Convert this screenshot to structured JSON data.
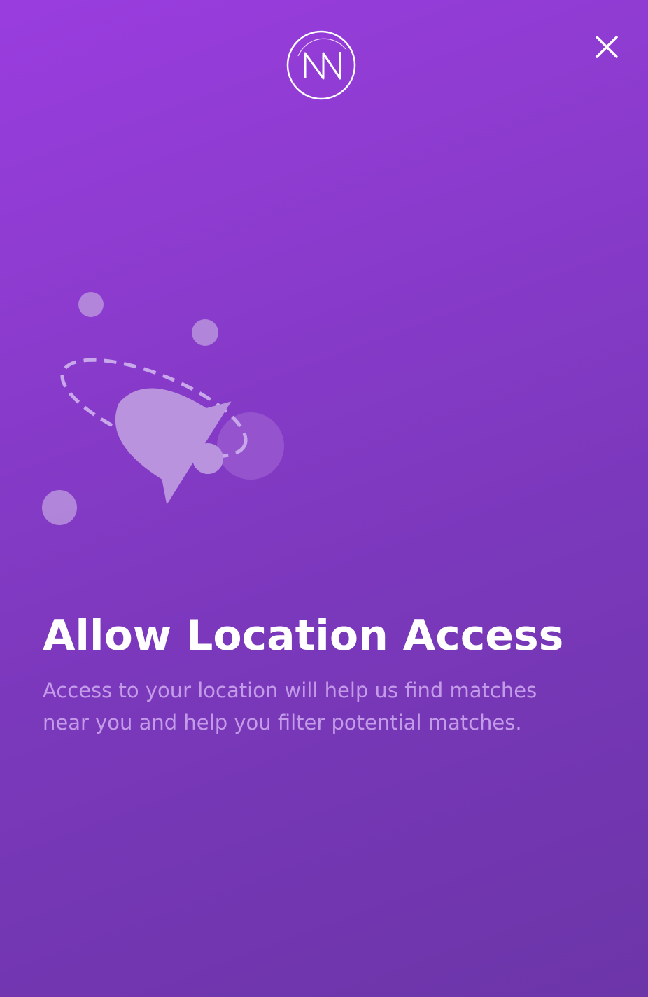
{
  "app": {
    "logo_icon": "monogram-m-logo-icon",
    "close_icon": "close-icon",
    "illustration_icon": "notification-bell-icon"
  },
  "permission": {
    "title": "Allow Location Access",
    "description": "Access to your location will help us find matches\nnear you and help you filter potential matches."
  },
  "colors": {
    "gradient_top": "#9a3ddf",
    "gradient_bottom": "#6c35a8",
    "title_text": "#ffffff",
    "description_text": "#c49be8",
    "illustration_fill": "#b993dd"
  }
}
